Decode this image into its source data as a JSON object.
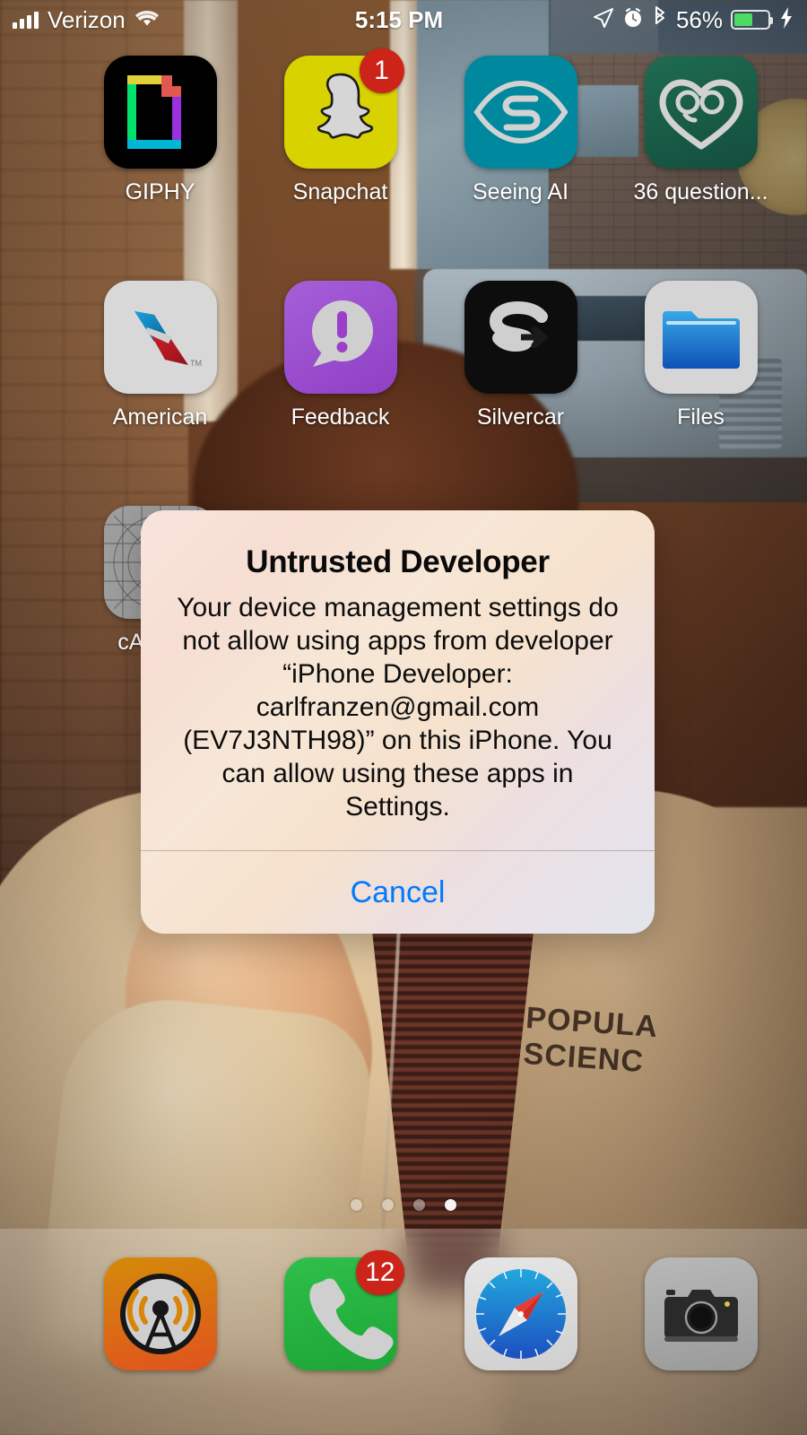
{
  "status_bar": {
    "carrier": "Verizon",
    "signal_icon": "cellular-bars-icon",
    "wifi_icon": "wifi-icon",
    "time": "5:15 PM",
    "location_icon": "location-arrow-icon",
    "alarm_icon": "alarm-clock-icon",
    "bluetooth_icon": "bluetooth-icon",
    "battery_percent": "56%",
    "battery_level": 56,
    "charging_icon": "lightning-bolt-icon",
    "battery_color": "#4cd964"
  },
  "home_screen": {
    "rows": [
      [
        {
          "label": "GIPHY",
          "icon": "giphy-icon",
          "badge": null
        },
        {
          "label": "Snapchat",
          "icon": "snapchat-icon",
          "badge": "1"
        },
        {
          "label": "Seeing AI",
          "icon": "seeing-ai-icon",
          "badge": null
        },
        {
          "label": "36 question...",
          "icon": "36-questions-icon",
          "badge": null
        }
      ],
      [
        {
          "label": "American",
          "icon": "american-airlines-icon",
          "badge": null
        },
        {
          "label": "Feedback",
          "icon": "feedback-icon",
          "badge": null
        },
        {
          "label": "Silvercar",
          "icon": "silvercar-icon",
          "badge": null
        },
        {
          "label": "Files",
          "icon": "files-icon",
          "badge": null
        }
      ],
      [
        {
          "label": "cARl the",
          "icon": "placeholder-app-icon",
          "badge": null
        }
      ]
    ]
  },
  "page_indicator": {
    "total": 4,
    "active_index": 3
  },
  "dock": {
    "items": [
      {
        "label": "",
        "icon": "overcast-icon",
        "badge": null
      },
      {
        "label": "",
        "icon": "phone-icon",
        "badge": "12"
      },
      {
        "label": "",
        "icon": "safari-icon",
        "badge": null
      },
      {
        "label": "",
        "icon": "camera-icon",
        "badge": null
      }
    ]
  },
  "alert": {
    "title": "Untrusted Developer",
    "message": "Your device management settings do not allow using apps from developer “iPhone Developer: carlfranzen@gmail.com (EV7J3NTH98)” on this iPhone. You can allow using these apps in Settings.",
    "buttons": [
      {
        "label": "Cancel",
        "color": "#007aff"
      }
    ]
  },
  "wallpaper": {
    "description": "Photo of a person resting hand on chin wearing a Popular Science hoodie in front of a brick wall and window",
    "hoodie_text": "POPULAR\nSCIENCE"
  }
}
